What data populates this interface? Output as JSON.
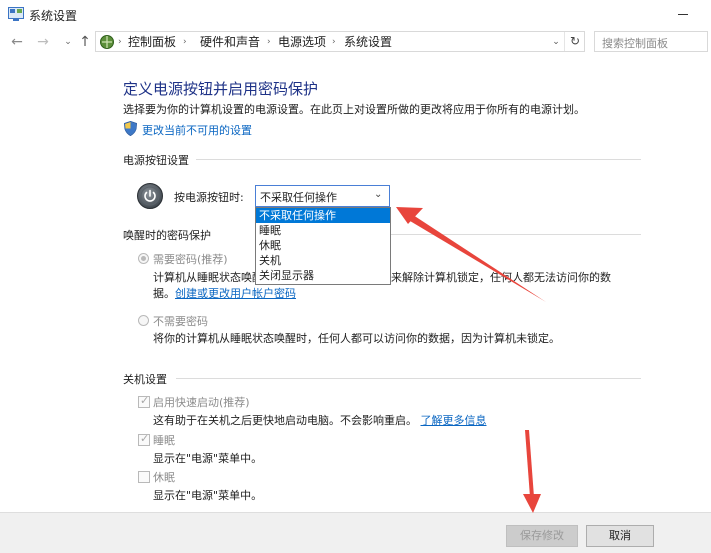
{
  "window": {
    "title": "系统设置"
  },
  "breadcrumb": [
    "控制面板",
    "硬件和声音",
    "电源选项",
    "系统设置"
  ],
  "search": {
    "placeholder": "搜索控制面板"
  },
  "page": {
    "heading": "定义电源按钮并启用密码保护",
    "description": "选择要为你的计算机设置的电源设置。在此页上对设置所做的更改将应用于你所有的电源计划。",
    "change_link": "更改当前不可用的设置"
  },
  "power_button": {
    "section_title": "电源按钮设置",
    "label": "按电源按钮时:",
    "selected": "不采取任何操作",
    "options": [
      "不采取任何操作",
      "睡眠",
      "休眠",
      "关机",
      "关闭显示器"
    ]
  },
  "wake_password": {
    "section_title": "唤醒时的密码保护",
    "require": {
      "label": "需要密码(推荐)",
      "desc_line1_left": "计算机从睡眠状态唤醒",
      "desc_line1_right": "来解除计算机锁定，任何人都无法访问你的数",
      "desc_line2_prefix": "据。",
      "desc_link": "创建或更改用户帐户密码",
      "checked": true
    },
    "no_require": {
      "label": "不需要密码",
      "desc": "将你的计算机从睡眠状态唤醒时，任何人都可以访问你的数据，因为计算机未锁定。",
      "checked": false
    }
  },
  "shutdown": {
    "section_title": "关机设置",
    "fast_startup": {
      "label": "启用快速启动(推荐)",
      "desc": "这有助于在关机之后更快地启动电脑。不会影响重启。",
      "link": "了解更多信息",
      "checked": true
    },
    "sleep": {
      "label": "睡眠",
      "desc": "显示在\"电源\"菜单中。",
      "checked": true
    },
    "hibernate": {
      "label": "休眠",
      "desc": "显示在\"电源\"菜单中。",
      "checked": false
    }
  },
  "footer": {
    "save": "保存修改",
    "cancel": "取消"
  },
  "colors": {
    "heading": "#1e3287",
    "link": "#0a66c2",
    "selection": "#0078d7",
    "annotation_arrow": "#e8453c"
  }
}
